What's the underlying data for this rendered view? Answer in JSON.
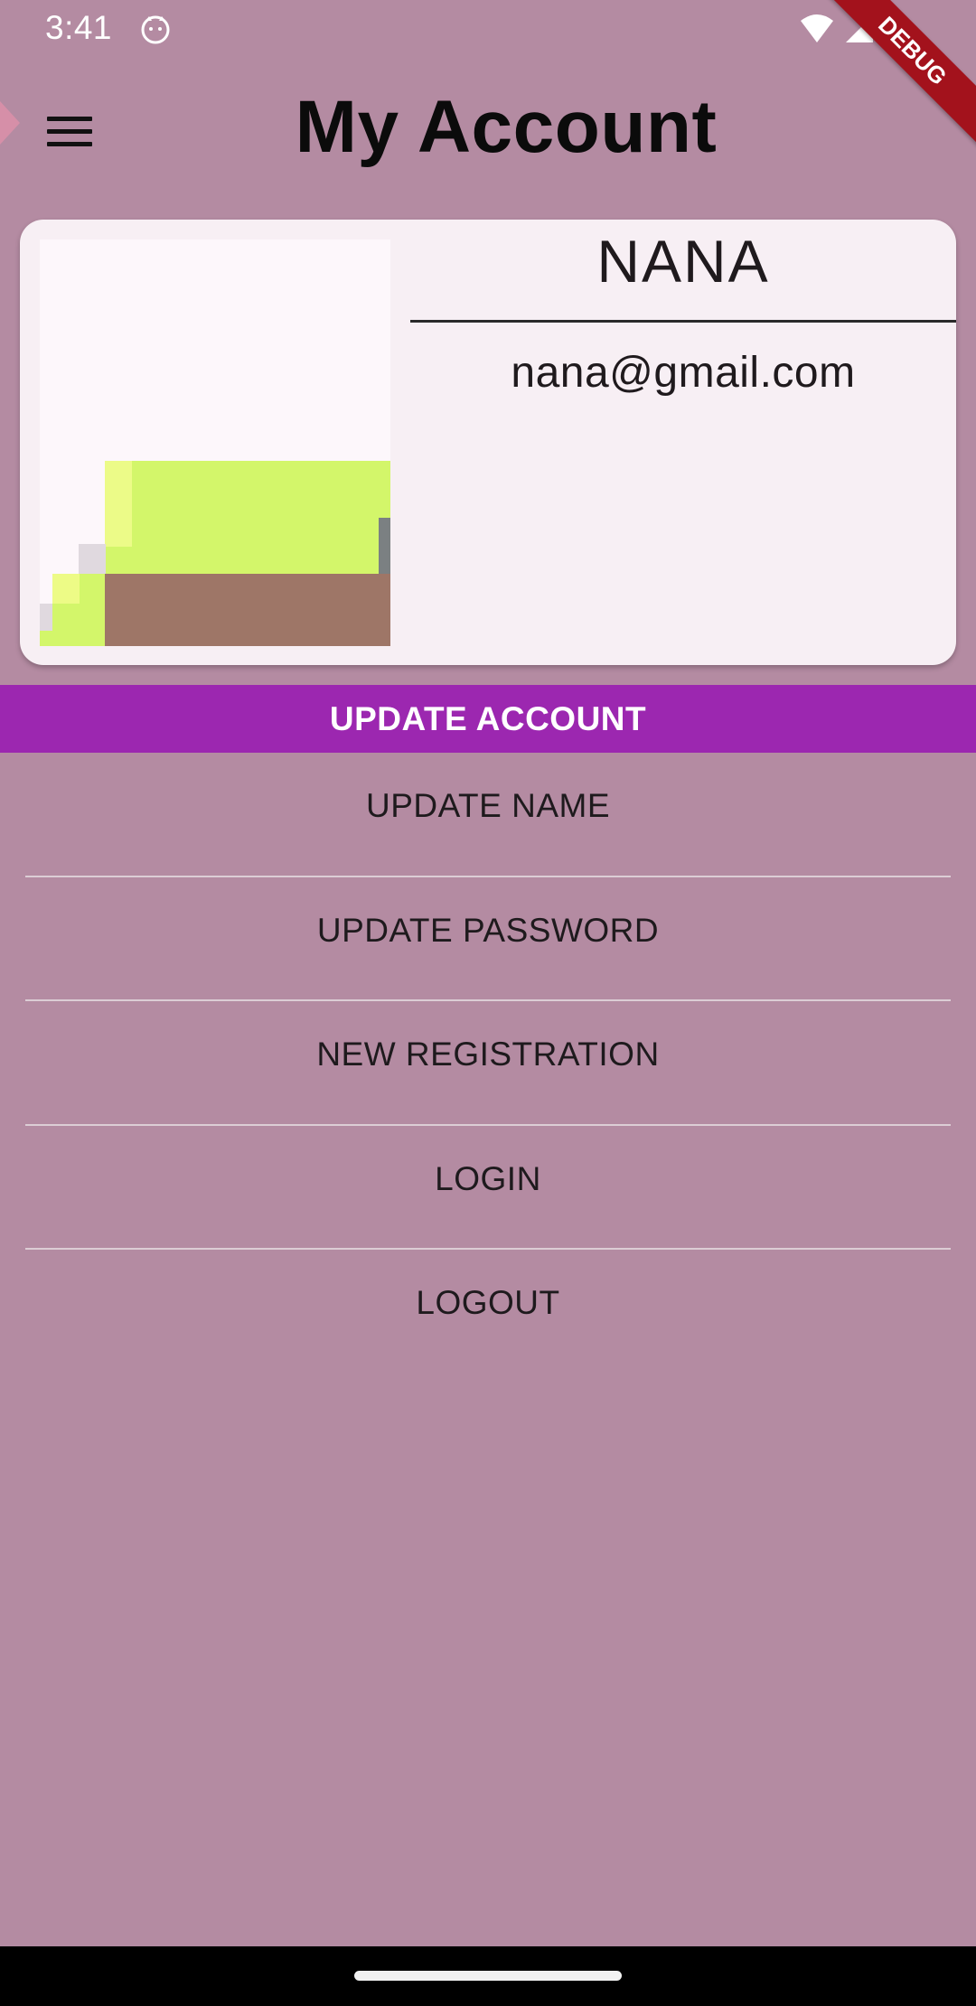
{
  "status_bar": {
    "time": "3:41",
    "icons": [
      "cat-app-icon",
      "wifi-icon",
      "signal-icon",
      "battery-icon"
    ]
  },
  "debug_banner": "DEBUG",
  "app_bar": {
    "title": "My Account",
    "menu_icon": "hamburger-menu-icon"
  },
  "profile": {
    "name": "NANA",
    "email": "nana@gmail.com"
  },
  "update_account_label": "UPDATE ACCOUNT",
  "menu": {
    "items": [
      {
        "label": "UPDATE NAME"
      },
      {
        "label": "UPDATE PASSWORD"
      },
      {
        "label": "NEW REGISTRATION"
      },
      {
        "label": "LOGIN"
      },
      {
        "label": "LOGOUT"
      }
    ]
  },
  "colors": {
    "background": "#b48ba2",
    "accent": "#9c27b0",
    "card": "#f7eff4",
    "debug_ribbon": "#a3121c"
  }
}
